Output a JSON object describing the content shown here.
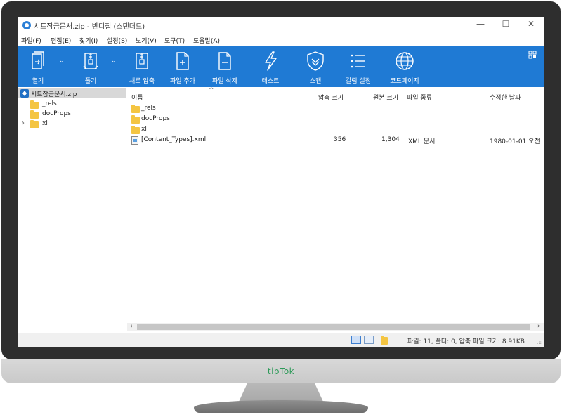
{
  "window": {
    "title": "시트잠금문서.zip - 반디집 (스탠더드)",
    "controls": {
      "minimize": "—",
      "maximize": "☐",
      "close": "✕"
    }
  },
  "menu": [
    {
      "label": "파일(F)"
    },
    {
      "label": "편집(E)"
    },
    {
      "label": "찾기(I)"
    },
    {
      "label": "설정(S)"
    },
    {
      "label": "보기(V)"
    },
    {
      "label": "도구(T)"
    },
    {
      "label": "도움말(A)"
    }
  ],
  "toolbar": {
    "open": "열기",
    "extract": "풀기",
    "new_archive": "새로 압축",
    "add_file": "파일 추가",
    "delete_file": "파일 삭제",
    "test": "테스트",
    "scan": "스캔",
    "column_settings": "칼럼 설정",
    "codepage": "코드페이지",
    "caret": "⌄"
  },
  "tree": {
    "root": "시트잠금문서.zip",
    "items": [
      {
        "label": "_rels"
      },
      {
        "label": "docProps"
      },
      {
        "label": "xl",
        "expander": "›"
      }
    ]
  },
  "list": {
    "columns": {
      "name": "이름",
      "packed": "압축 크기",
      "original": "원본 크기",
      "type": "파일 종류",
      "modified": "수정한 날짜",
      "sort_indicator": "^"
    },
    "rows": [
      {
        "name": "_rels",
        "packed": "",
        "original": "",
        "type": "",
        "modified": "",
        "kind": "folder"
      },
      {
        "name": "docProps",
        "packed": "",
        "original": "",
        "type": "",
        "modified": "",
        "kind": "folder"
      },
      {
        "name": "xl",
        "packed": "",
        "original": "",
        "type": "",
        "modified": "",
        "kind": "folder"
      },
      {
        "name": "[Content_Types].xml",
        "packed": "356",
        "original": "1,304",
        "type": "XML 문서",
        "modified": "1980-01-01 오전",
        "kind": "file"
      }
    ]
  },
  "scroll": {
    "left": "‹",
    "right": "›"
  },
  "status": {
    "text": "파일: 11, 폴더: 0, 압축 파일 크기: 8.91KB",
    "grip": ".::"
  },
  "monitor": {
    "brand": "tipTok"
  },
  "colors": {
    "toolbar": "#1f7ad4",
    "folder": "#f4c542",
    "brand": "#2e9a59"
  }
}
